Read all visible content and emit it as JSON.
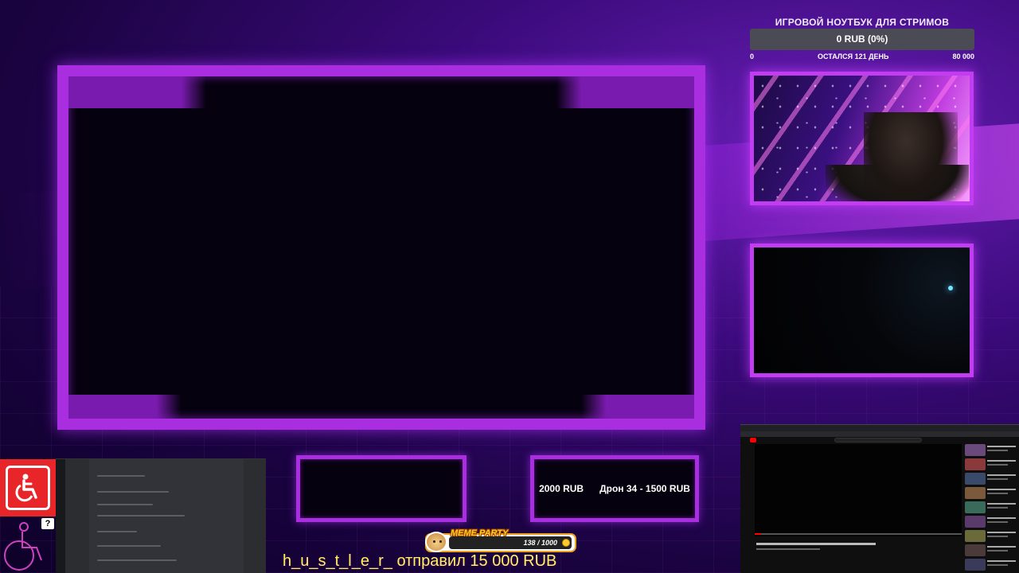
{
  "goal": {
    "title": "ИГРОВОЙ НОУТБУК ДЛЯ СТРИМОВ",
    "progress_text": "0 RUB (0%)",
    "progress_fraction": 0,
    "start": "0",
    "remaining": "ОСТАЛСЯ 121 ДЕНЬ",
    "target": "80 000"
  },
  "ticker": {
    "text": "2000 RUB      Дрон 34 - 1500 RUB"
  },
  "meme_party": {
    "logo": "MEME PARTY",
    "counter": "138 / 1000"
  },
  "alert": {
    "text": "h_u_s_t_l_e_r_ отправил 15 000 RUB"
  },
  "colors": {
    "frame_purple": "#a82ee0",
    "cam_border": "#c23cf2",
    "alert_yellow": "#fff25a",
    "access_red": "#e8262a"
  },
  "icons": {
    "access": "wheelchair-icon",
    "coin": "coin-icon",
    "help": "question-icon"
  },
  "help_badge": "?"
}
